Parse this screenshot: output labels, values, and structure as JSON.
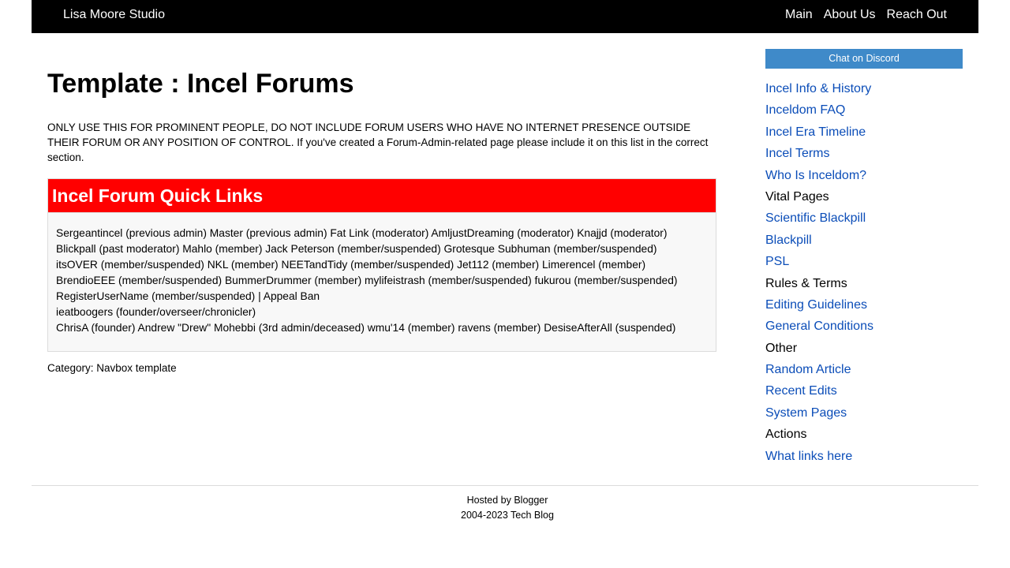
{
  "header": {
    "site_title": "Lisa Moore Studio",
    "nav": [
      "Main",
      "About Us",
      "Reach Out"
    ]
  },
  "main": {
    "page_title": "Template : Incel Forums",
    "notice": "ONLY USE THIS FOR PROMINENT PEOPLE, DO NOT INCLUDE FORUM USERS WHO HAVE NO INTERNET PRESENCE OUTSIDE THEIR FORUM OR ANY POSITION OF CONTROL. If you've created a Forum-Admin-related page please include it on this list in the correct section.",
    "navbox": {
      "title": "Incel Forum Quick Links",
      "header_color": "#ff0000",
      "lines": [
        "Sergeantincel (previous admin) Master (previous admin) Fat Link (moderator) AmljustDreaming (moderator) Knajjd (moderator)",
        "Blickpall (past moderator) Mahlo (member) Jack Peterson (member/suspended) Grotesque Subhuman (member/suspended)",
        "itsOVER (member/suspended) NKL (member) NEETandTidy (member/suspended) Jet112 (member) Limerencel (member)",
        "BrendioEEE (member/suspended) BummerDrummer (member) mylifeistrash (member/suspended) fukurou (member/suspended)",
        "RegisterUserName (member/suspended) | Appeal Ban",
        "ieatboogers (founder/overseer/chronicler)",
        "ChrisA (founder) Andrew \"Drew\" Mohebbi (3rd admin/deceased) wmu'14 (member) ravens (member) DesiseAfterAll (suspended)"
      ]
    },
    "category": "Category: Navbox template"
  },
  "sidebar": {
    "discord_button": "Chat on Discord",
    "items": [
      {
        "label": "Incel Info & History",
        "type": "link"
      },
      {
        "label": "Inceldom FAQ",
        "type": "link"
      },
      {
        "label": "Incel Era Timeline",
        "type": "link"
      },
      {
        "label": "Incel Terms",
        "type": "link"
      },
      {
        "label": "Who Is Inceldom?",
        "type": "link"
      },
      {
        "label": "Vital Pages",
        "type": "heading"
      },
      {
        "label": "Scientific Blackpill",
        "type": "link"
      },
      {
        "label": "Blackpill",
        "type": "link"
      },
      {
        "label": "PSL",
        "type": "link"
      },
      {
        "label": "Rules & Terms",
        "type": "heading"
      },
      {
        "label": "Editing Guidelines",
        "type": "link"
      },
      {
        "label": "General Conditions",
        "type": "link"
      },
      {
        "label": "Other",
        "type": "heading"
      },
      {
        "label": "Random Article",
        "type": "link"
      },
      {
        "label": "Recent Edits",
        "type": "link"
      },
      {
        "label": "System Pages",
        "type": "link"
      },
      {
        "label": "Actions",
        "type": "heading"
      },
      {
        "label": "What links here",
        "type": "link"
      }
    ],
    "link_color": "#0b4db8",
    "button_color": "#3f8ac9"
  },
  "footer": {
    "line1": "Hosted by Blogger",
    "line2": "2004-2023 Tech Blog"
  }
}
